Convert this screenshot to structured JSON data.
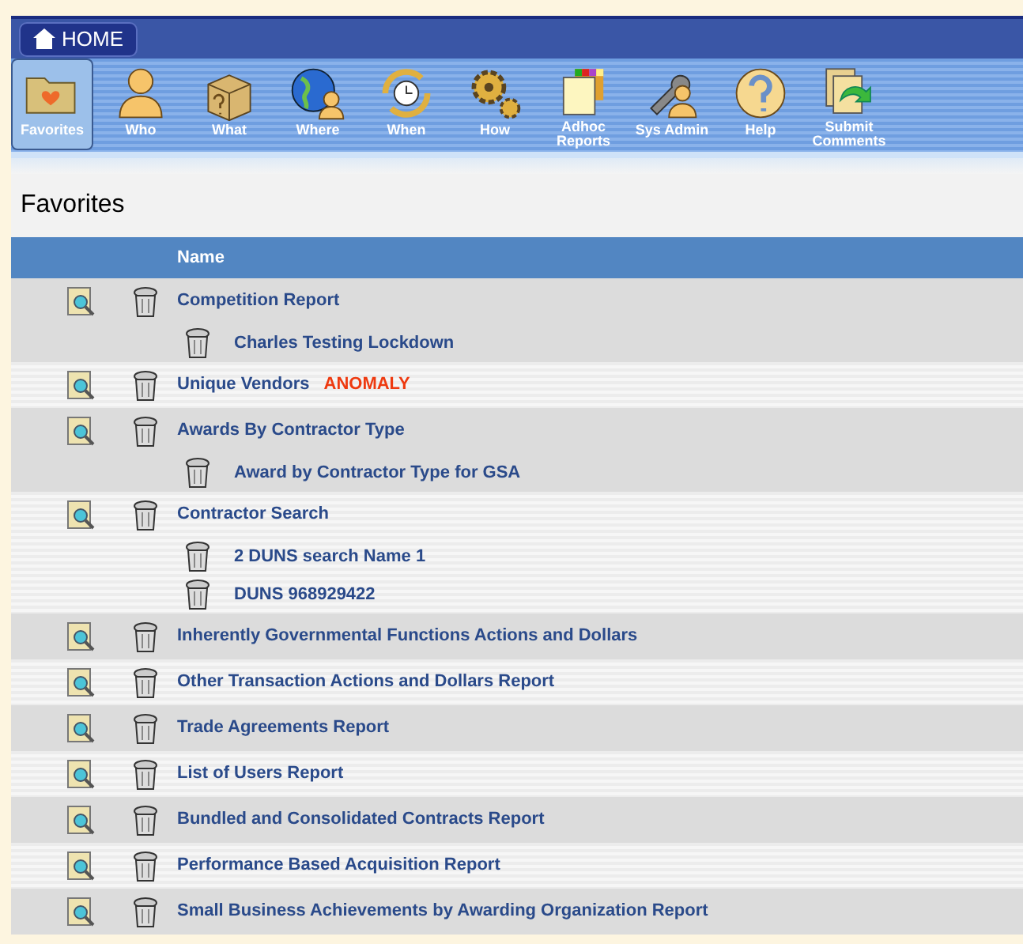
{
  "home_button": {
    "label": "HOME"
  },
  "toolbar": [
    {
      "label": "Favorites",
      "kind": "folder",
      "selected": true
    },
    {
      "label": "Who",
      "kind": "person",
      "selected": false
    },
    {
      "label": "What",
      "kind": "box",
      "selected": false
    },
    {
      "label": "Where",
      "kind": "globe",
      "selected": false
    },
    {
      "label": "When",
      "kind": "clock",
      "selected": false
    },
    {
      "label": "How",
      "kind": "gears",
      "selected": false
    },
    {
      "label": "Adhoc Reports",
      "kind": "grid",
      "selected": false
    },
    {
      "label": "Sys Admin",
      "kind": "wrench",
      "selected": false
    },
    {
      "label": "Help",
      "kind": "help",
      "selected": false
    },
    {
      "label": "Submit Comments",
      "kind": "submit",
      "selected": false
    }
  ],
  "page_title": "Favorites",
  "table": {
    "columns": [
      "Name"
    ],
    "rows": [
      {
        "name": "Competition Report",
        "children": [
          {
            "name": "Charles Testing Lockdown"
          }
        ]
      },
      {
        "name": "Unique Vendors",
        "tag": "ANOMALY"
      },
      {
        "name": "Awards By Contractor Type",
        "children": [
          {
            "name": "Award by Contractor Type for GSA"
          }
        ]
      },
      {
        "name": "Contractor Search",
        "children": [
          {
            "name": "2 DUNS search Name 1"
          },
          {
            "name": "DUNS 968929422"
          }
        ]
      },
      {
        "name": "Inherently Governmental Functions Actions and Dollars"
      },
      {
        "name": "Other Transaction Actions and Dollars Report"
      },
      {
        "name": "Trade Agreements Report"
      },
      {
        "name": "List of Users Report"
      },
      {
        "name": "Bundled and Consolidated Contracts Report"
      },
      {
        "name": "Performance Based Acquisition Report"
      },
      {
        "name": "Small Business Achievements by Awarding Organization Report"
      }
    ]
  }
}
